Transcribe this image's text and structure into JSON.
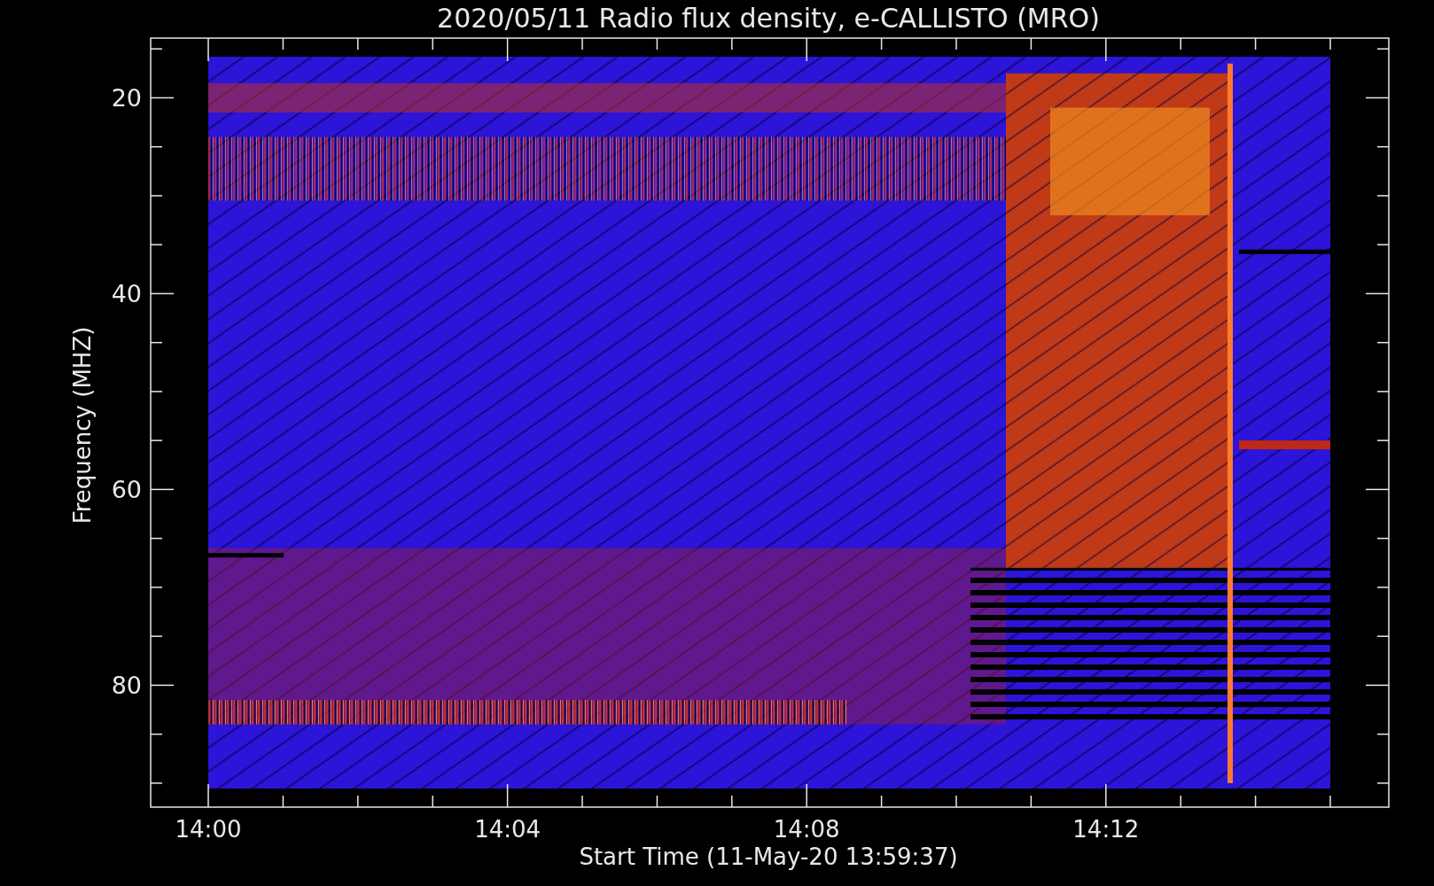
{
  "title": "2020/05/11  Radio flux density, e-CALLISTO (MRO)",
  "y_axis": {
    "label": "Frequency (MHZ)",
    "ticks": [
      "20",
      "40",
      "60",
      "80"
    ]
  },
  "x_axis": {
    "label": "Start Time (11-May-20 13:59:37)",
    "ticks": [
      "14:00",
      "14:04",
      "14:08",
      "14:12"
    ]
  }
}
